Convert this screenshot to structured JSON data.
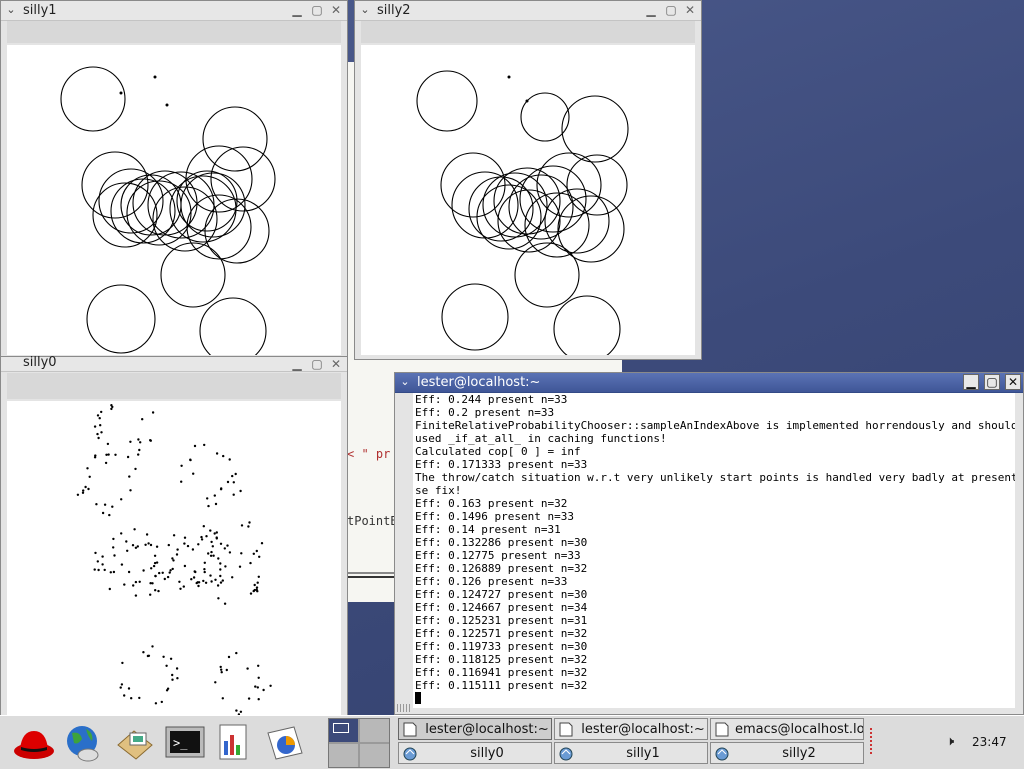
{
  "windows": {
    "silly1": {
      "title": "silly1"
    },
    "silly2": {
      "title": "silly2"
    },
    "silly0": {
      "title": "silly0"
    },
    "terminal": {
      "title": "lester@localhost:~",
      "lines": [
        "Eff: 0.244 present n=33",
        "Eff: 0.2 present n=33",
        "FiniteRelativeProbabilityChooser::sampleAnIndexAbove is implemented horrendously and should only be",
        "used _if_at_all_ in caching functions!",
        "Calculated cop[ 0 ] = inf",
        "Eff: 0.171333 present n=33",
        "The throw/catch situation w.r.t very unlikely start points is handled very badly at present ... plea",
        "se fix!",
        "Eff: 0.163 present n=32",
        "Eff: 0.1496 present n=33",
        "Eff: 0.14 present n=31",
        "Eff: 0.132286 present n=30",
        "Eff: 0.12775 present n=33",
        "Eff: 0.126889 present n=32",
        "Eff: 0.126 present n=33",
        "Eff: 0.124727 present n=30",
        "Eff: 0.124667 present n=34",
        "Eff: 0.125231 present n=31",
        "Eff: 0.122571 present n=32",
        "Eff: 0.119733 present n=30",
        "Eff: 0.118125 present n=32",
        "Eff: 0.116941 present n=32",
        "Eff: 0.115111 present n=32"
      ]
    }
  },
  "emacs_peek": {
    "str_fragment": "< \" pr",
    "code_fragment": "tPointB"
  },
  "controls": {
    "minimize": "▁",
    "maximize": "▢",
    "close": "✕",
    "menu": "⌄"
  },
  "taskbar": {
    "launchers": [
      "redhat-menu-icon",
      "web-browser-icon",
      "mail-icon",
      "terminal-icon",
      "office-writer-icon",
      "office-presentation-icon"
    ],
    "tasks_top": [
      "lester@localhost:~",
      "lester@localhost:~",
      "emacs@localhost.local"
    ],
    "tasks_bottom": [
      "silly0",
      "silly1",
      "silly2"
    ],
    "clock": "23:47",
    "volume_icon": "speaker-icon"
  },
  "colors": {
    "desktop": "#3c4a7a",
    "active_title": "#4b63a6",
    "panel": "#dcdcdc"
  }
}
